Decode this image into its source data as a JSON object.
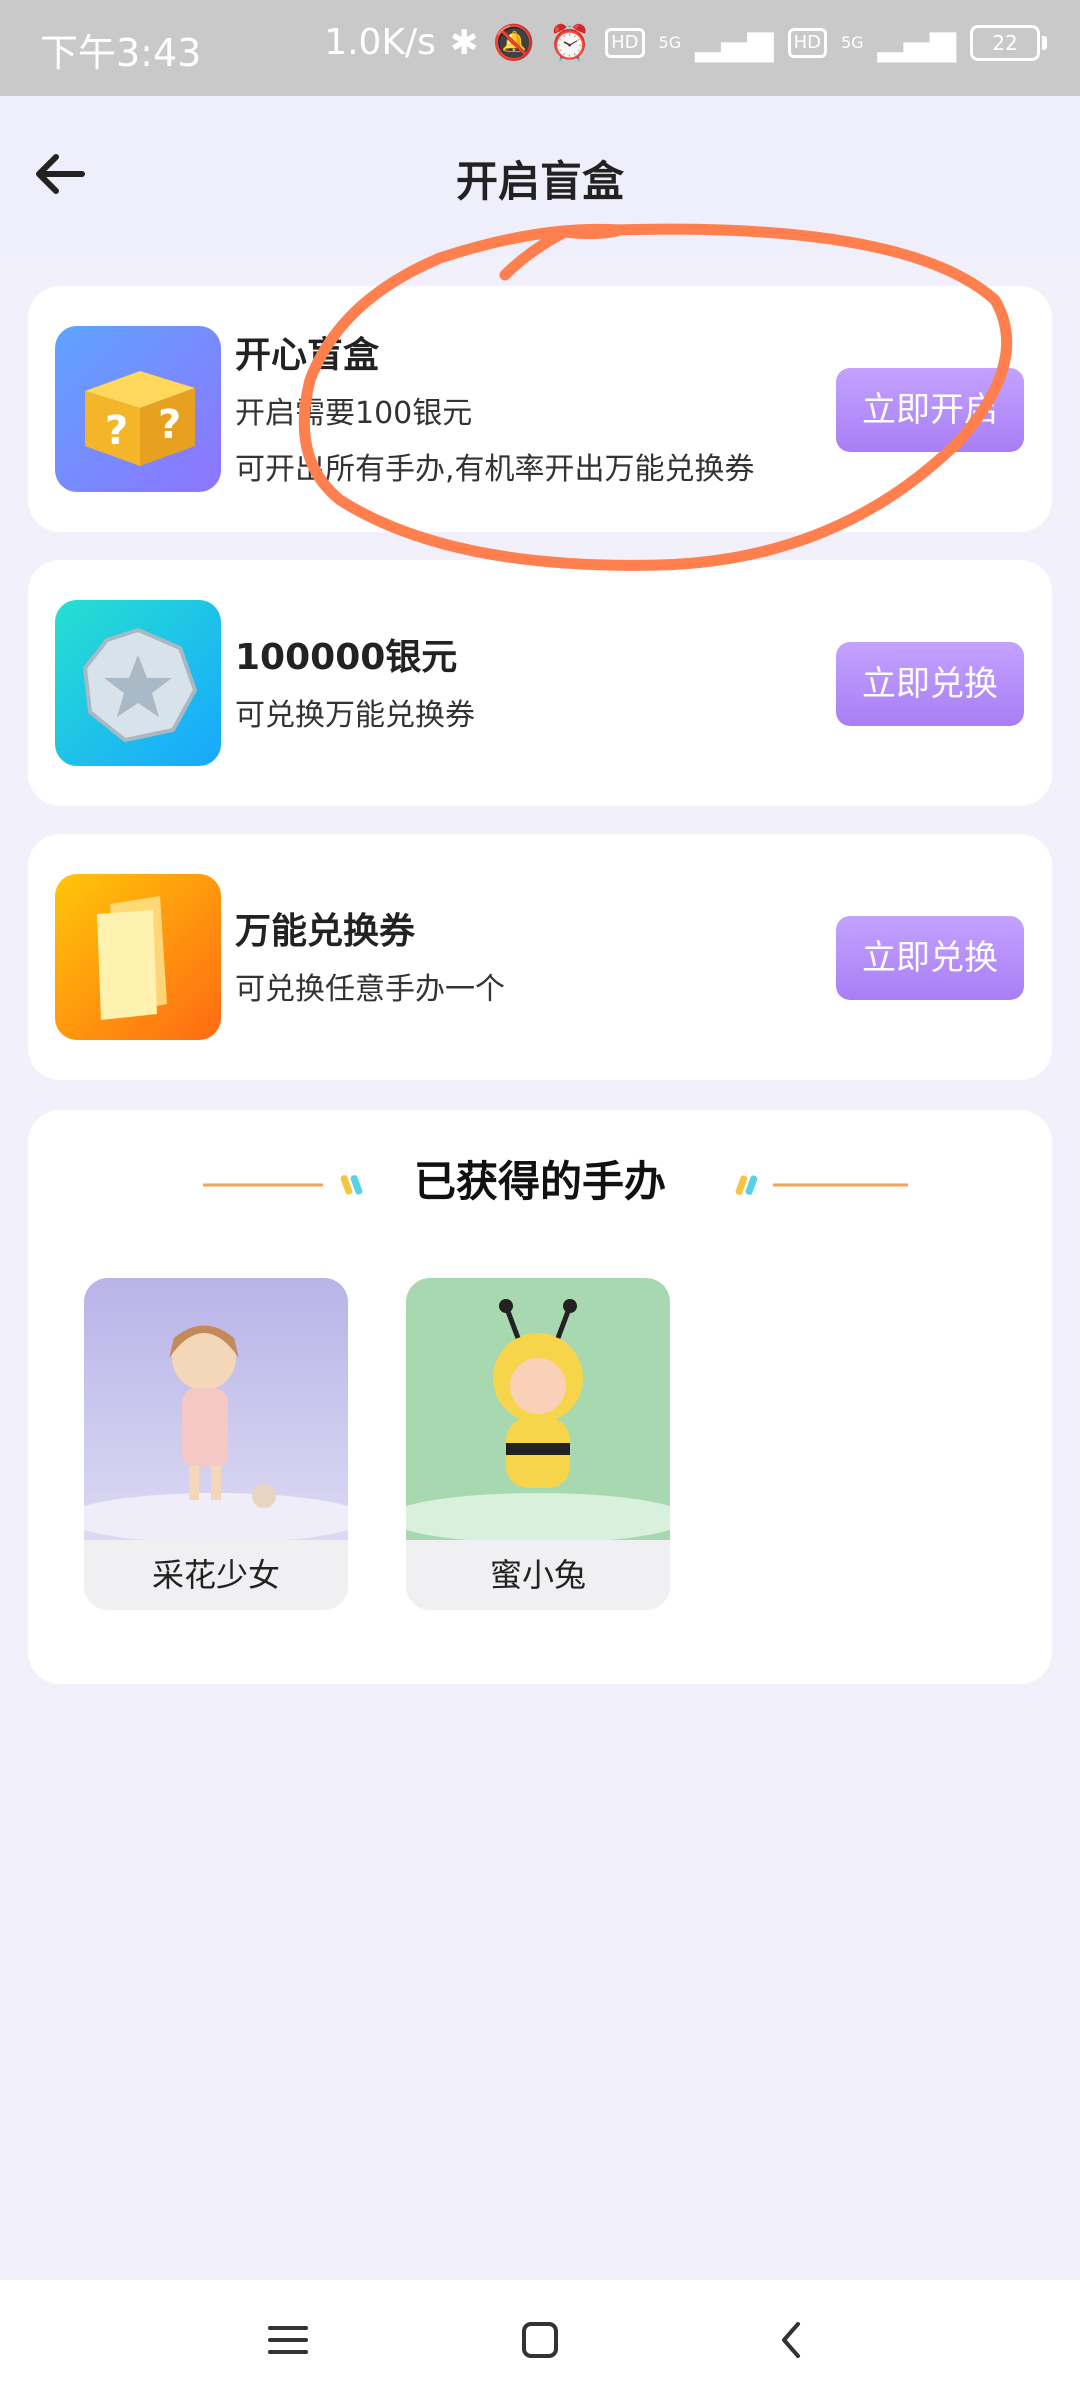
{
  "status_bar": {
    "time": "下午3:43",
    "net_speed": "1.0K/s",
    "hd1": "HD",
    "net1": "5G",
    "hd2": "HD",
    "net2": "5G",
    "battery": "22"
  },
  "header": {
    "title": "开启盲盒",
    "back_icon": "arrow-left-icon"
  },
  "cards": [
    {
      "name": "开心盲盒",
      "desc1": "开启需要100银元",
      "desc2": "可开出所有手办,有机率开出万能兑换券",
      "button": "立即开启",
      "icon": "mystery-box-icon"
    },
    {
      "name": "100000银元",
      "desc1": "可兑换万能兑换券",
      "button": "立即兑换",
      "icon": "silver-coin-icon"
    },
    {
      "name": "万能兑换券",
      "desc1": "可兑换任意手办一个",
      "button": "立即兑换",
      "icon": "ticket-icon"
    }
  ],
  "acquired": {
    "title": "已获得的手办",
    "figures": [
      {
        "name": "采花少女"
      },
      {
        "name": "蜜小兔"
      }
    ]
  },
  "colors": {
    "accent": "#a97ef5",
    "background": "#f1f0fb",
    "annotation": "#ff7f4f"
  }
}
